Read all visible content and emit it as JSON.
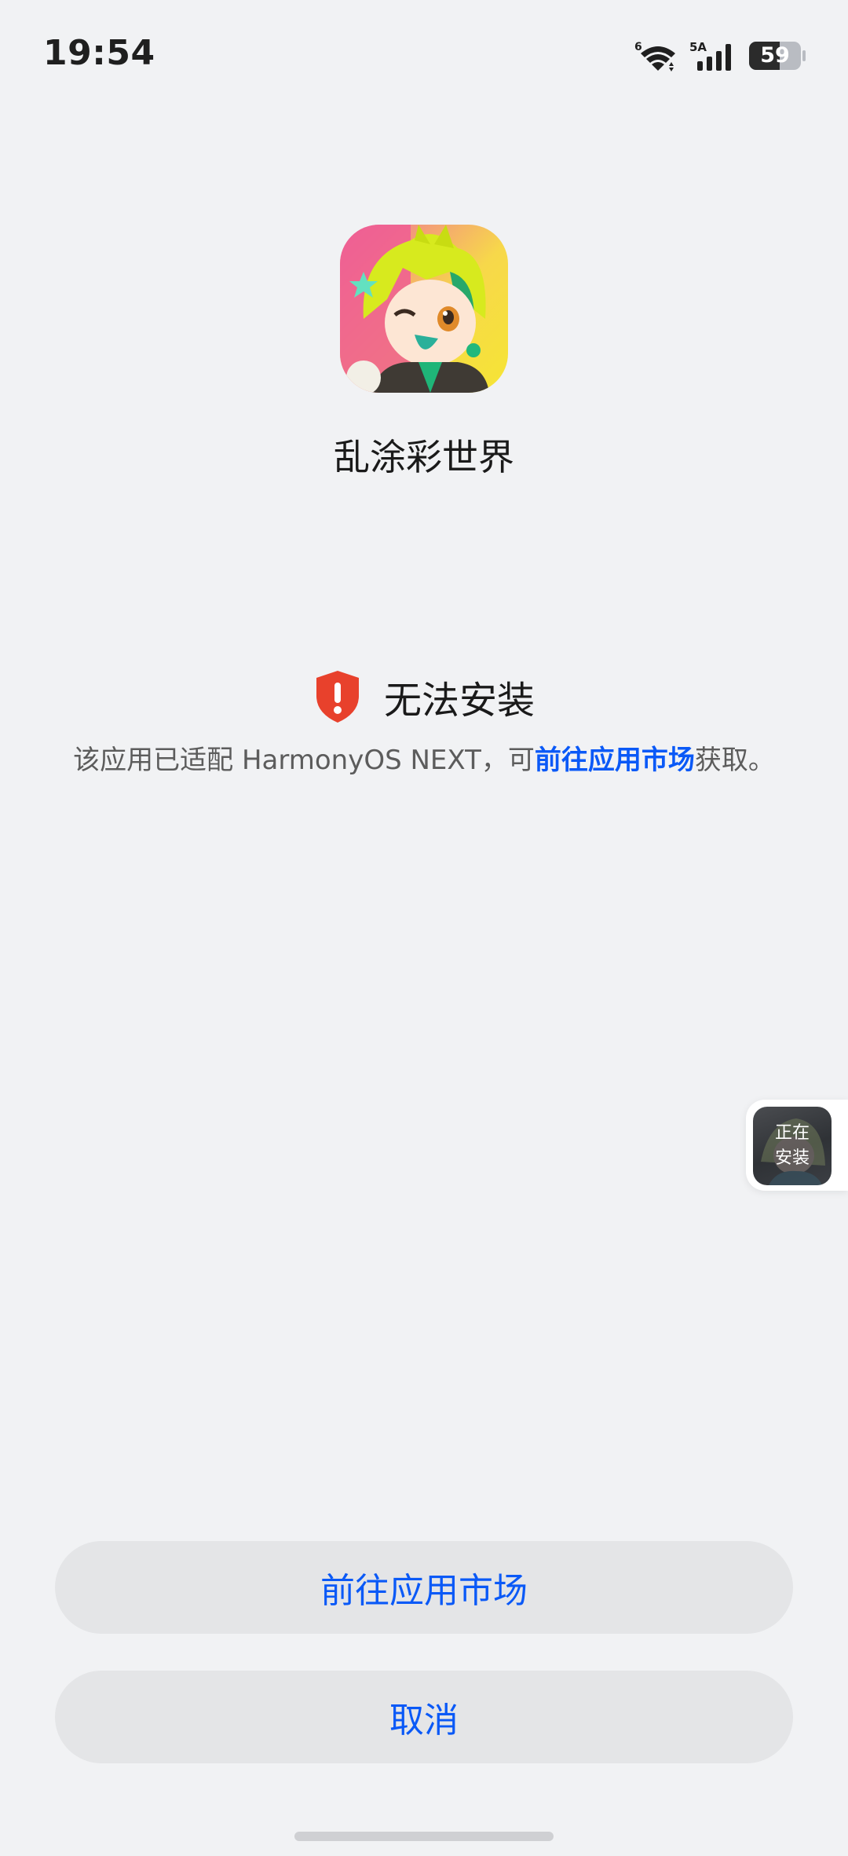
{
  "status_bar": {
    "time": "19:54",
    "wifi_badge": "6",
    "network_type": "5A",
    "battery_level": "59",
    "battery_fraction": 0.59
  },
  "app": {
    "name": "乱涂彩世界",
    "icon": "app-anime-character-icon"
  },
  "install_status": {
    "icon": "shield-alert-icon",
    "icon_color": "#e8412c",
    "title": "无法安装",
    "desc_prefix": "该应用已适配 HarmonyOS NEXT，可",
    "desc_link": "前往应用市场",
    "desc_suffix": "获取。",
    "link_color": "#0a59f7"
  },
  "floating_bubble": {
    "line1": "正在",
    "line2": "安装"
  },
  "buttons": {
    "go_market": "前往应用市场",
    "cancel": "取消"
  }
}
